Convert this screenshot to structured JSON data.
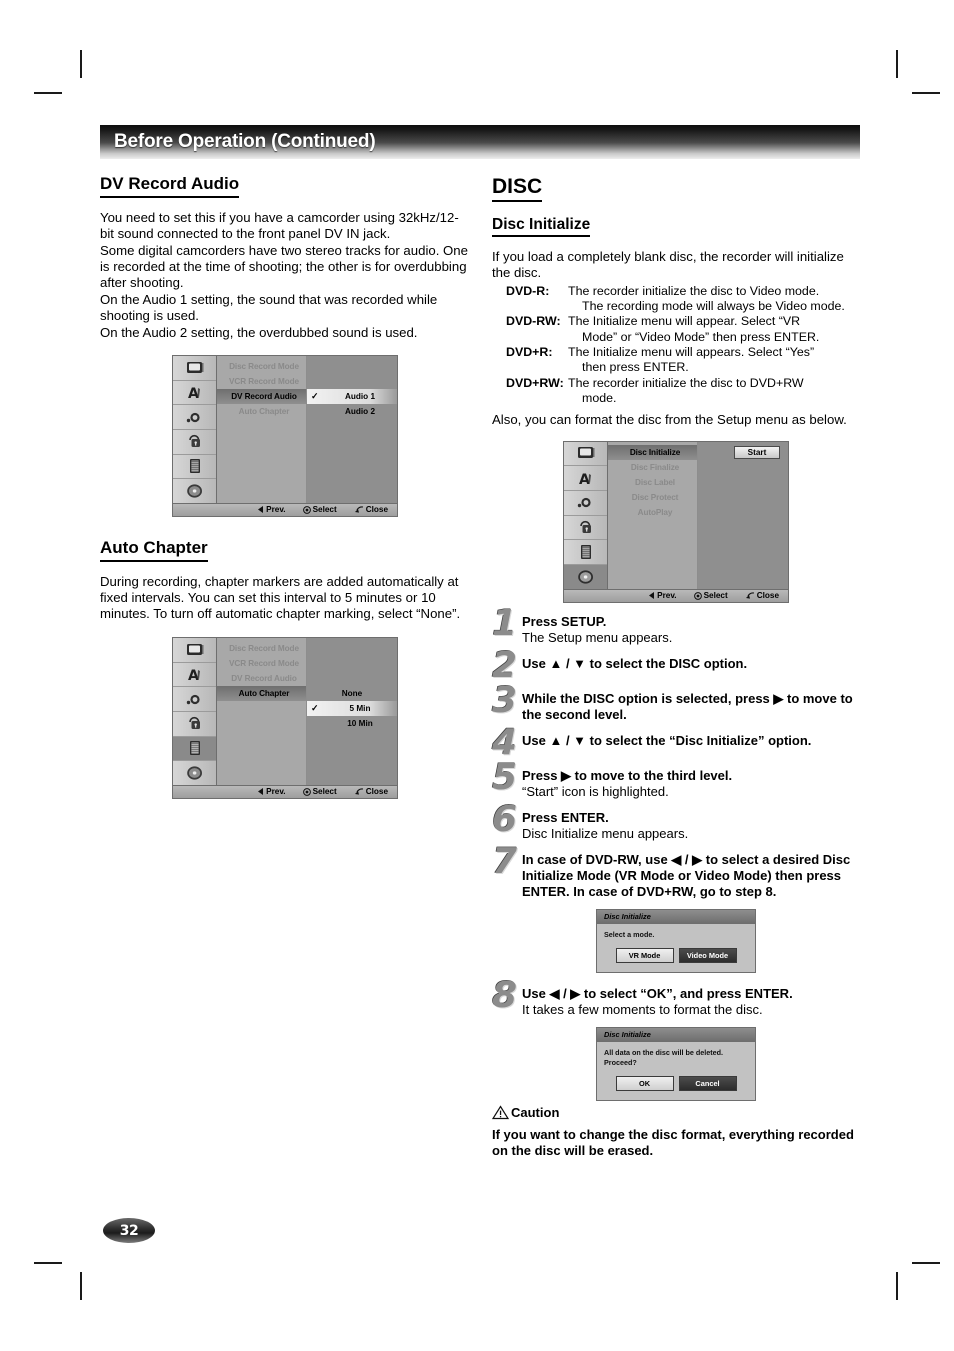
{
  "header": {
    "title": "Before Operation (Continued)"
  },
  "page_number": "32",
  "left": {
    "dv_record_audio": {
      "heading": "DV Record Audio",
      "paragraphs": [
        "You need to set this if you have a camcorder using 32kHz/12-bit sound connected to the front panel DV IN jack.",
        "Some digital camcorders have two stereo tracks for audio. One is recorded at the time of shooting; the other is for overdubbing after shooting.",
        "On the Audio 1 setting, the sound that was recorded while shooting is used.",
        "On the Audio 2 setting, the overdubbed sound is used."
      ]
    },
    "auto_chapter": {
      "heading": "Auto Chapter",
      "paragraphs": [
        "During recording, chapter markers are added automatically at fixed intervals. You can set this interval to 5 minutes or 10 minutes. To turn off automatic chapter marking, select “None”."
      ]
    }
  },
  "right": {
    "disc_heading": "DISC",
    "disc_initialize_heading": "Disc Initialize",
    "intro": "If you load a completely blank disc, the recorder will initialize the disc.",
    "definitions": [
      {
        "term": "DVD-R:",
        "lines": [
          "The recorder initialize the disc to Video mode.",
          "The recording mode will always be Video mode."
        ]
      },
      {
        "term": "DVD-RW:",
        "lines": [
          "The Initialize menu will appear. Select “VR",
          "Mode” or “Video Mode” then press ENTER."
        ]
      },
      {
        "term": "DVD+R:",
        "lines": [
          "The Initialize menu will appears. Select “Yes”",
          "then press ENTER."
        ]
      },
      {
        "term": "DVD+RW:",
        "lines": [
          "The recorder initialize the disc to DVD+RW",
          "mode."
        ]
      }
    ],
    "outro": "Also, you can format the disc from the Setup menu as below.",
    "steps": [
      {
        "num": "1",
        "main": "Press SETUP.",
        "sub": "The Setup menu appears."
      },
      {
        "num": "2",
        "main": "Use ▲ / ▼ to select the DISC option.",
        "sub": ""
      },
      {
        "num": "3",
        "main": "While the DISC option is selected, press ▶ to move to the second level.",
        "sub": ""
      },
      {
        "num": "4",
        "main": "Use ▲ / ▼ to select the “Disc Initialize” option.",
        "sub": ""
      },
      {
        "num": "5",
        "main": "Press ▶ to move to the third level.",
        "sub": "“Start” icon is highlighted.",
        "sub_bold_prefix": "“Start”"
      },
      {
        "num": "6",
        "main": "Press ENTER.",
        "sub": "Disc Initialize menu appears."
      },
      {
        "num": "7",
        "main": "In case of DVD-RW, use ◀ / ▶ to select a desired Disc Initialize Mode (VR Mode or Video Mode) then press ENTER. In case of DVD+RW, go to step 8.",
        "sub": ""
      },
      {
        "num": "8",
        "main": "Use ◀ / ▶ to select “OK”, and press ENTER.",
        "sub": "It takes a few moments to format the disc."
      }
    ],
    "caution": {
      "label": "Caution",
      "text": "If you want to change the disc format, everything recorded on the disc will be erased."
    }
  },
  "osd_footer": {
    "prev": "Prev.",
    "select": "Select",
    "close": "Close"
  },
  "menus": {
    "dv_record_audio": {
      "items": [
        {
          "label": "Disc Record Mode",
          "active": false
        },
        {
          "label": "VCR Record Mode",
          "active": false
        },
        {
          "label": "DV Record Audio",
          "active": true
        },
        {
          "label": "Auto Chapter",
          "active": false
        }
      ],
      "options": [
        {
          "label": "Audio 1",
          "checked": true,
          "highlighted": true
        },
        {
          "label": "Audio 2",
          "checked": false,
          "highlighted": false
        }
      ],
      "selected_icon_index": 4
    },
    "auto_chapter": {
      "items": [
        {
          "label": "Disc Record Mode",
          "active": false
        },
        {
          "label": "VCR Record Mode",
          "active": false
        },
        {
          "label": "DV Record Audio",
          "active": false
        },
        {
          "label": "Auto Chapter",
          "active": true
        }
      ],
      "options": [
        {
          "label": "None",
          "checked": false,
          "highlighted": false
        },
        {
          "label": "5 Min",
          "checked": true,
          "highlighted": true
        },
        {
          "label": "10 Min",
          "checked": false,
          "highlighted": false
        }
      ],
      "selected_icon_index": 4
    },
    "disc_initialize": {
      "items": [
        {
          "label": "Disc Initialize",
          "active": true
        },
        {
          "label": "Disc Finalize",
          "active": false
        },
        {
          "label": "Disc Label",
          "active": false
        },
        {
          "label": "Disc Protect",
          "active": false
        },
        {
          "label": "AutoPlay",
          "active": false
        }
      ],
      "start_button": "Start",
      "selected_icon_index": 5
    }
  },
  "dialogs": {
    "select_mode": {
      "title": "Disc Initialize",
      "message": "Select a mode.",
      "buttons": [
        {
          "label": "VR Mode",
          "selected": false
        },
        {
          "label": "Video Mode",
          "selected": true
        }
      ]
    },
    "confirm_delete": {
      "title": "Disc Initialize",
      "message_line1": "All data on the disc will be deleted.",
      "message_line2": "Proceed?",
      "buttons": [
        {
          "label": "OK",
          "selected": false
        },
        {
          "label": "Cancel",
          "selected": true
        }
      ]
    }
  }
}
